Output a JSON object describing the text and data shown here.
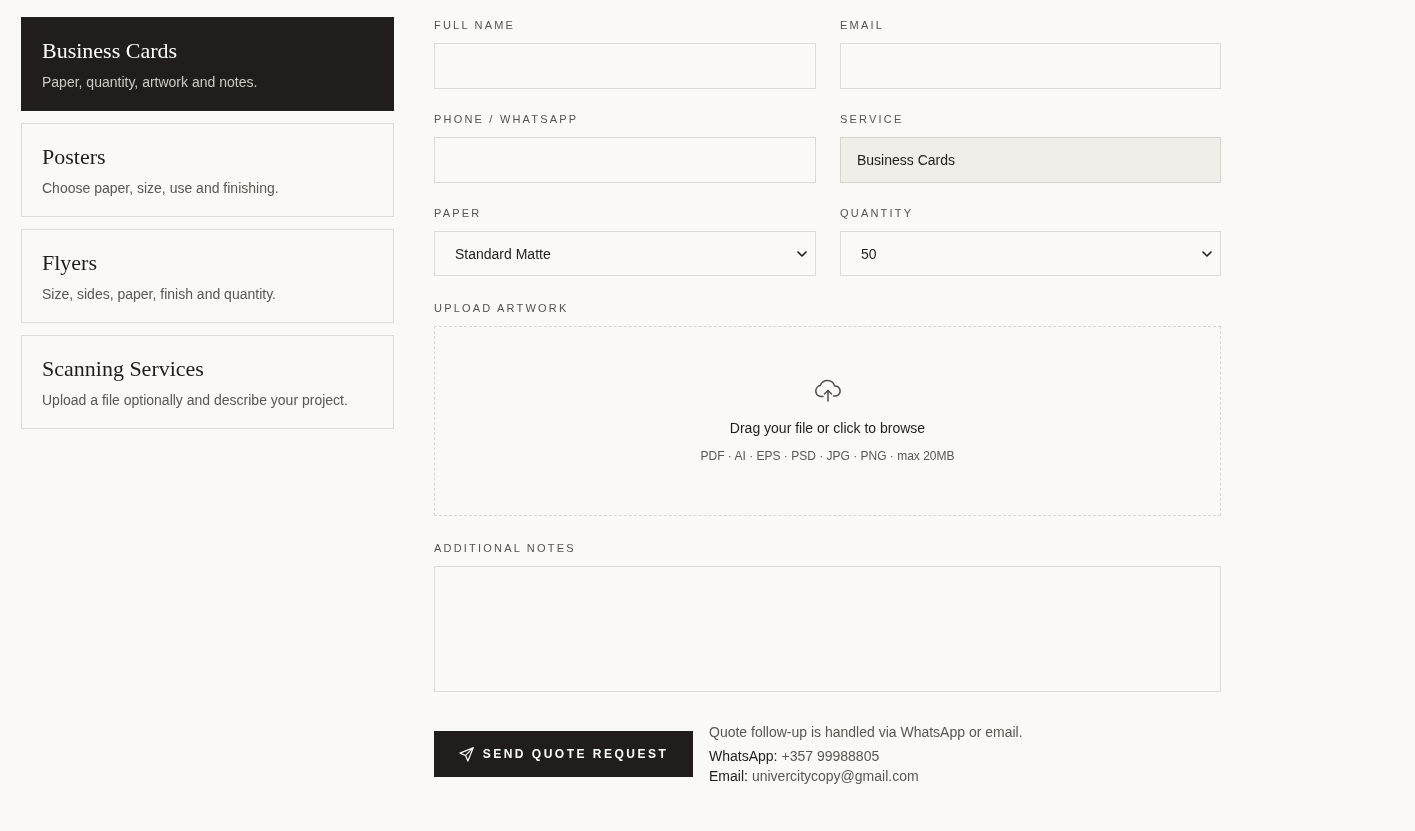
{
  "services": [
    {
      "title": "Business Cards",
      "description": "Paper, quantity, artwork and notes.",
      "selected": true
    },
    {
      "title": "Posters",
      "description": "Choose paper, size, use and finishing.",
      "selected": false
    },
    {
      "title": "Flyers",
      "description": "Size, sides, paper, finish and quantity.",
      "selected": false
    },
    {
      "title": "Scanning Services",
      "description": "Upload a file optionally and describe your project.",
      "selected": false
    }
  ],
  "form": {
    "fields": [
      {
        "kind": "text",
        "label": "FULL NAME",
        "readonly": false
      },
      {
        "kind": "text",
        "label": "EMAIL",
        "readonly": false
      },
      {
        "kind": "text",
        "label": "PHONE / WHATSAPP",
        "readonly": false
      },
      {
        "kind": "text",
        "label": "SERVICE",
        "value": "Business Cards",
        "readonly": true
      },
      {
        "kind": "select",
        "label": "PAPER",
        "value": "Standard Matte",
        "readonly": false
      },
      {
        "kind": "select",
        "label": "QUANTITY",
        "value": "50",
        "readonly": false
      }
    ],
    "upload": {
      "label": "UPLOAD ARTWORK",
      "prompt": "Drag your file or click to browse",
      "formats": "PDF · AI · EPS · PSD · JPG · PNG · max 20MB"
    },
    "notes": {
      "label": "ADDITIONAL NOTES"
    },
    "submit": "SEND QUOTE REQUEST",
    "contact": {
      "note": "Quote follow-up is handled via WhatsApp or email.",
      "lines": [
        {
          "label": "WhatsApp:",
          "value": "+357 99988805"
        },
        {
          "label": "Email:",
          "value": "univercitycopy@gmail.com"
        }
      ]
    }
  }
}
